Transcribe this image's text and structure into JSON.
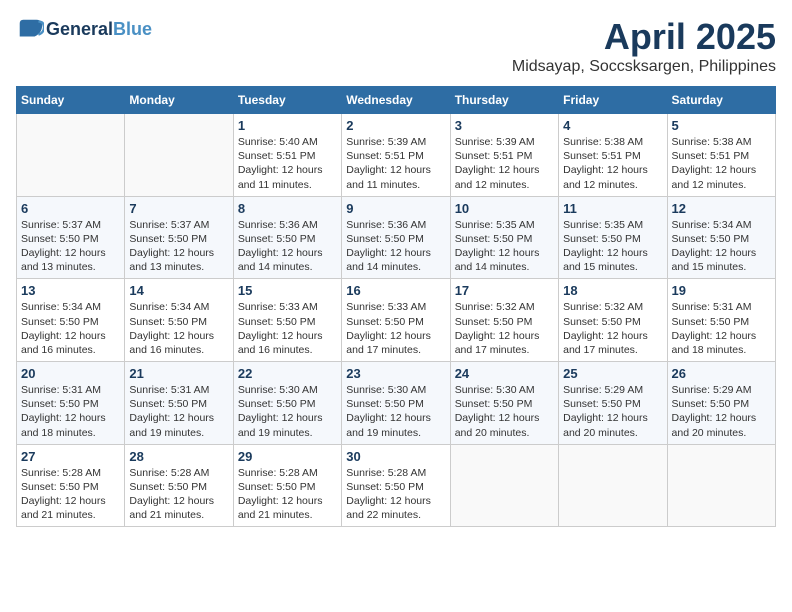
{
  "header": {
    "logo_line1": "General",
    "logo_line2": "Blue",
    "month_year": "April 2025",
    "location": "Midsayap, Soccsksargen, Philippines"
  },
  "weekdays": [
    "Sunday",
    "Monday",
    "Tuesday",
    "Wednesday",
    "Thursday",
    "Friday",
    "Saturday"
  ],
  "weeks": [
    [
      {
        "day": "",
        "info": ""
      },
      {
        "day": "",
        "info": ""
      },
      {
        "day": "1",
        "info": "Sunrise: 5:40 AM\nSunset: 5:51 PM\nDaylight: 12 hours and 11 minutes."
      },
      {
        "day": "2",
        "info": "Sunrise: 5:39 AM\nSunset: 5:51 PM\nDaylight: 12 hours and 11 minutes."
      },
      {
        "day": "3",
        "info": "Sunrise: 5:39 AM\nSunset: 5:51 PM\nDaylight: 12 hours and 12 minutes."
      },
      {
        "day": "4",
        "info": "Sunrise: 5:38 AM\nSunset: 5:51 PM\nDaylight: 12 hours and 12 minutes."
      },
      {
        "day": "5",
        "info": "Sunrise: 5:38 AM\nSunset: 5:51 PM\nDaylight: 12 hours and 12 minutes."
      }
    ],
    [
      {
        "day": "6",
        "info": "Sunrise: 5:37 AM\nSunset: 5:50 PM\nDaylight: 12 hours and 13 minutes."
      },
      {
        "day": "7",
        "info": "Sunrise: 5:37 AM\nSunset: 5:50 PM\nDaylight: 12 hours and 13 minutes."
      },
      {
        "day": "8",
        "info": "Sunrise: 5:36 AM\nSunset: 5:50 PM\nDaylight: 12 hours and 14 minutes."
      },
      {
        "day": "9",
        "info": "Sunrise: 5:36 AM\nSunset: 5:50 PM\nDaylight: 12 hours and 14 minutes."
      },
      {
        "day": "10",
        "info": "Sunrise: 5:35 AM\nSunset: 5:50 PM\nDaylight: 12 hours and 14 minutes."
      },
      {
        "day": "11",
        "info": "Sunrise: 5:35 AM\nSunset: 5:50 PM\nDaylight: 12 hours and 15 minutes."
      },
      {
        "day": "12",
        "info": "Sunrise: 5:34 AM\nSunset: 5:50 PM\nDaylight: 12 hours and 15 minutes."
      }
    ],
    [
      {
        "day": "13",
        "info": "Sunrise: 5:34 AM\nSunset: 5:50 PM\nDaylight: 12 hours and 16 minutes."
      },
      {
        "day": "14",
        "info": "Sunrise: 5:34 AM\nSunset: 5:50 PM\nDaylight: 12 hours and 16 minutes."
      },
      {
        "day": "15",
        "info": "Sunrise: 5:33 AM\nSunset: 5:50 PM\nDaylight: 12 hours and 16 minutes."
      },
      {
        "day": "16",
        "info": "Sunrise: 5:33 AM\nSunset: 5:50 PM\nDaylight: 12 hours and 17 minutes."
      },
      {
        "day": "17",
        "info": "Sunrise: 5:32 AM\nSunset: 5:50 PM\nDaylight: 12 hours and 17 minutes."
      },
      {
        "day": "18",
        "info": "Sunrise: 5:32 AM\nSunset: 5:50 PM\nDaylight: 12 hours and 17 minutes."
      },
      {
        "day": "19",
        "info": "Sunrise: 5:31 AM\nSunset: 5:50 PM\nDaylight: 12 hours and 18 minutes."
      }
    ],
    [
      {
        "day": "20",
        "info": "Sunrise: 5:31 AM\nSunset: 5:50 PM\nDaylight: 12 hours and 18 minutes."
      },
      {
        "day": "21",
        "info": "Sunrise: 5:31 AM\nSunset: 5:50 PM\nDaylight: 12 hours and 19 minutes."
      },
      {
        "day": "22",
        "info": "Sunrise: 5:30 AM\nSunset: 5:50 PM\nDaylight: 12 hours and 19 minutes."
      },
      {
        "day": "23",
        "info": "Sunrise: 5:30 AM\nSunset: 5:50 PM\nDaylight: 12 hours and 19 minutes."
      },
      {
        "day": "24",
        "info": "Sunrise: 5:30 AM\nSunset: 5:50 PM\nDaylight: 12 hours and 20 minutes."
      },
      {
        "day": "25",
        "info": "Sunrise: 5:29 AM\nSunset: 5:50 PM\nDaylight: 12 hours and 20 minutes."
      },
      {
        "day": "26",
        "info": "Sunrise: 5:29 AM\nSunset: 5:50 PM\nDaylight: 12 hours and 20 minutes."
      }
    ],
    [
      {
        "day": "27",
        "info": "Sunrise: 5:28 AM\nSunset: 5:50 PM\nDaylight: 12 hours and 21 minutes."
      },
      {
        "day": "28",
        "info": "Sunrise: 5:28 AM\nSunset: 5:50 PM\nDaylight: 12 hours and 21 minutes."
      },
      {
        "day": "29",
        "info": "Sunrise: 5:28 AM\nSunset: 5:50 PM\nDaylight: 12 hours and 21 minutes."
      },
      {
        "day": "30",
        "info": "Sunrise: 5:28 AM\nSunset: 5:50 PM\nDaylight: 12 hours and 22 minutes."
      },
      {
        "day": "",
        "info": ""
      },
      {
        "day": "",
        "info": ""
      },
      {
        "day": "",
        "info": ""
      }
    ]
  ]
}
